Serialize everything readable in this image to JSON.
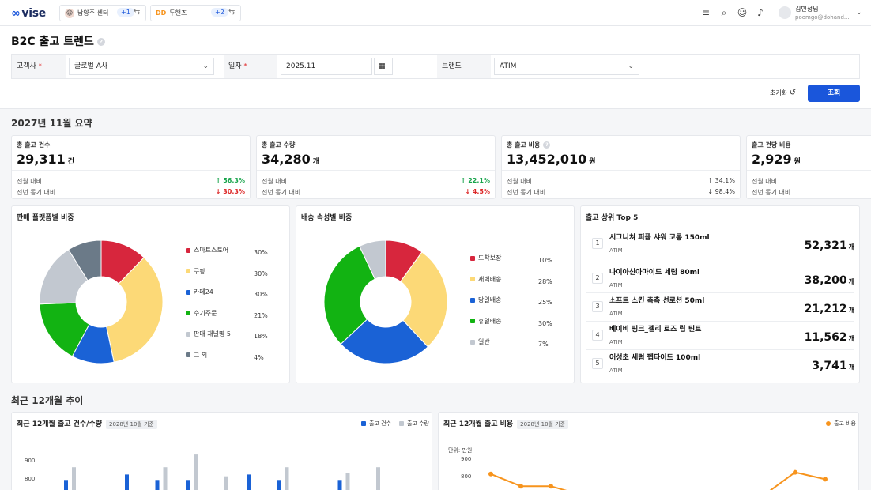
{
  "topbar": {
    "logo": "vise",
    "center_name": "남양주 센터",
    "center_badge": "+1",
    "brand_name": "두핸즈",
    "brand_badge": "+2",
    "user_name": "김민성님",
    "user_email": "poomgo@dohand..."
  },
  "page": {
    "title": "B2C 출고 트렌드"
  },
  "filter": {
    "customer_label": "고객사",
    "customer_value": "글로벌 A사",
    "date_label": "일자",
    "date_value": "2025.11",
    "brand_label": "브랜드",
    "brand_value": "ATIM",
    "required_mark": "*"
  },
  "actions": {
    "reset_label": "초기화",
    "query_label": "조회"
  },
  "summary": {
    "title": "2027년 11월 요약",
    "mom_label": "전월 대비",
    "yoy_label": "전년 동기 대비",
    "cards": [
      {
        "label": "총 출고 건수",
        "value": "29,311",
        "unit": "건",
        "mom": "↑ 56.3%",
        "yoy": "↓ 30.3%",
        "mom_dir": "up",
        "yoy_dir": "down"
      },
      {
        "label": "총 출고 수량",
        "value": "34,280",
        "unit": "개",
        "mom": "↑ 22.1%",
        "yoy": "↓ 4.5%",
        "mom_dir": "up",
        "yoy_dir": "down"
      },
      {
        "label": "총 출고 비용",
        "value": "13,452,010",
        "unit": "원",
        "mom": "↑ 34.1%",
        "yoy": "↓ 98.4%",
        "mom_dir": "neutral",
        "yoy_dir": "neutral"
      },
      {
        "label": "출고 건당 비용",
        "value": "2,929",
        "unit": "원",
        "mom": "",
        "yoy": "",
        "mom_dir": "neutral",
        "yoy_dir": "neutral"
      }
    ]
  },
  "platform": {
    "title": "판매 플랫폼별 비중",
    "items": [
      {
        "label": "스마트스토어",
        "pct": "30%",
        "color": "#d7263d"
      },
      {
        "label": "쿠팡",
        "pct": "30%",
        "color": "#fcd977"
      },
      {
        "label": "카페24",
        "pct": "30%",
        "color": "#1a62d6"
      },
      {
        "label": "수기주문",
        "pct": "21%",
        "color": "#12b312"
      },
      {
        "label": "판매 채널명 5",
        "pct": "18%",
        "color": "#c2c8d0"
      },
      {
        "label": "그 외",
        "pct": "4%",
        "color": "#6b7a88"
      }
    ],
    "slice_values": [
      11,
      31,
      10,
      15,
      15,
      8
    ]
  },
  "delivery": {
    "title": "배송 속성별 비중",
    "items": [
      {
        "label": "도착보장",
        "pct": "10%",
        "color": "#d7263d"
      },
      {
        "label": "새벽배송",
        "pct": "28%",
        "color": "#fcd977"
      },
      {
        "label": "당일배송",
        "pct": "25%",
        "color": "#1a62d6"
      },
      {
        "label": "휴일배송",
        "pct": "30%",
        "color": "#12b312"
      },
      {
        "label": "일반",
        "pct": "7%",
        "color": "#c2c8d0"
      }
    ]
  },
  "top5": {
    "title": "출고 상위 Top 5",
    "items": [
      {
        "rank": "1",
        "name": "시그니쳐 퍼퓸 샤워 코롱 150ml",
        "brand": "ATIM",
        "value": "52,321",
        "unit": "개"
      },
      {
        "rank": "2",
        "name": "나이아신아마이드 세럼 80ml",
        "brand": "ATIM",
        "value": "38,200",
        "unit": "개"
      },
      {
        "rank": "3",
        "name": "소프트 스킨 촉촉 선로션 50ml",
        "brand": "ATIM",
        "value": "21,212",
        "unit": "개"
      },
      {
        "rank": "4",
        "name": "베이비 핑크_젤리 로즈 립 틴트",
        "brand": "ATIM",
        "value": "11,562",
        "unit": "개"
      },
      {
        "rank": "5",
        "name": "어성초 세럼 펩타이드 100ml",
        "brand": "ATIM",
        "value": "3,741",
        "unit": "개"
      }
    ]
  },
  "trend": {
    "title": "최근 12개월 추이",
    "chart1_title": "최근 12개월 출고 건수/수량",
    "chart1_basis": "2028년 10월 기준",
    "chart1_legend_a": "출고 건수",
    "chart1_legend_b": "출고 수량",
    "chart2_title": "최근 12개월 출고 비용",
    "chart2_basis": "2028년 10월 기준",
    "chart2_legend": "출고 비용",
    "chart2_unit": "단위: 만원"
  },
  "chart_data": [
    {
      "type": "bar",
      "title": "최근 12개월 출고 건수/수량",
      "y_ticks": [
        "900",
        "800"
      ],
      "series": [
        {
          "name": "출고 건수",
          "color": "#1a62d6",
          "values": [
            790,
            0,
            820,
            790,
            790,
            0,
            820,
            790,
            0,
            790,
            0,
            0
          ]
        },
        {
          "name": "출고 수량",
          "color": "#c2c8d0",
          "values": [
            860,
            0,
            0,
            860,
            930,
            810,
            0,
            860,
            0,
            830,
            860,
            0
          ]
        }
      ]
    },
    {
      "type": "line",
      "title": "최근 12개월 출고 비용",
      "y_ticks": [
        "900",
        "800",
        "700"
      ],
      "series": [
        {
          "name": "출고 비용",
          "color": "#f7941d",
          "values": [
            810,
            740,
            740,
            690,
            null,
            null,
            null,
            null,
            null,
            690,
            820,
            780
          ]
        }
      ]
    }
  ]
}
